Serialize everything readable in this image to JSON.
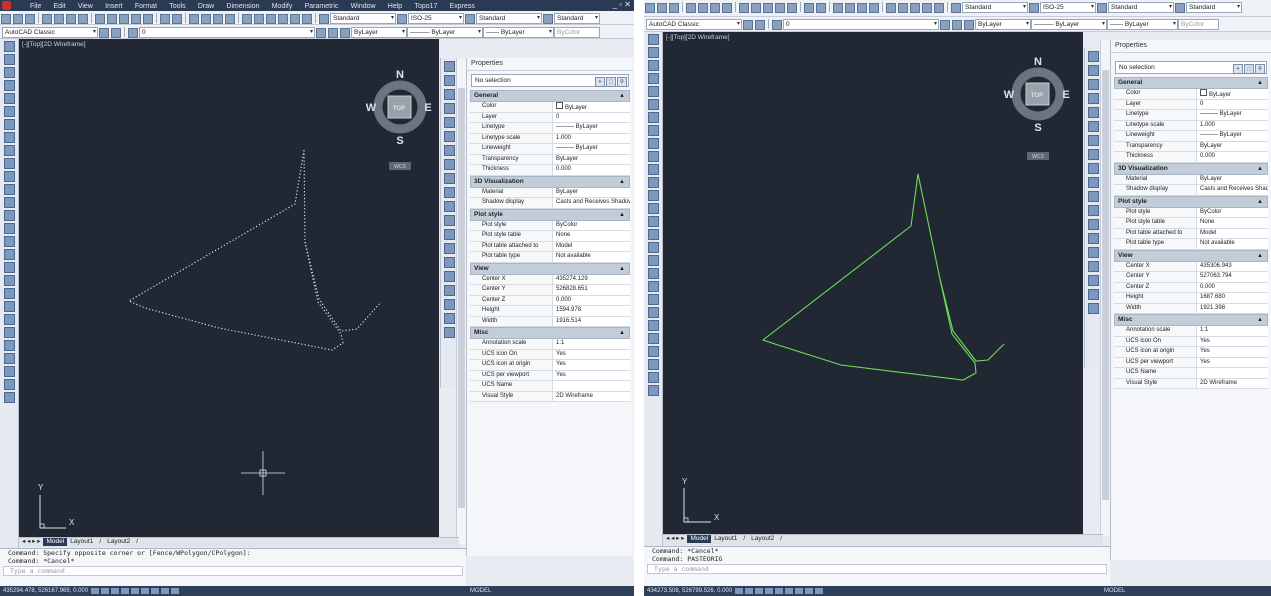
{
  "menu": [
    "File",
    "Edit",
    "View",
    "Insert",
    "Format",
    "Tools",
    "Draw",
    "Dimension",
    "Modify",
    "Parametric",
    "Window",
    "Help",
    "Topo17",
    "Express"
  ],
  "toolbar": {
    "style_text": "Standard",
    "dim_style": "ISO-25",
    "table_style": "Standard",
    "ml_style": "Standard",
    "workspace": "AutoCAD Classic",
    "layer": "0",
    "layer_right": "ByLayer",
    "color": "ByLayer",
    "linetype": "ByLayer",
    "lineweight": "ByLayer",
    "plotstyle": "ByColor"
  },
  "viewport_label": "[-][Top][2D Wireframe]",
  "compass": {
    "n": "N",
    "s": "S",
    "e": "E",
    "w": "W",
    "top": "TOP",
    "wcs": "WCS"
  },
  "ucs": {
    "x": "X",
    "y": "Y"
  },
  "left_window": {
    "props_title": "Properties",
    "selection": "No selection",
    "groups": [
      {
        "name": "General",
        "rows": [
          [
            "Color",
            "ByLayer"
          ],
          [
            "Layer",
            "0"
          ],
          [
            "Linetype",
            "——— ByLayer"
          ],
          [
            "Linetype scale",
            "1.000"
          ],
          [
            "Lineweight",
            "——— ByLayer"
          ],
          [
            "Transparency",
            "ByLayer"
          ],
          [
            "Thickness",
            "0.000"
          ]
        ]
      },
      {
        "name": "3D Visualization",
        "rows": [
          [
            "Material",
            "ByLayer"
          ],
          [
            "Shadow display",
            "Casts and Receives Shadows"
          ]
        ]
      },
      {
        "name": "Plot style",
        "rows": [
          [
            "Plot style",
            "ByColor"
          ],
          [
            "Plot style table",
            "None"
          ],
          [
            "Plot table attached to",
            "Model"
          ],
          [
            "Plot table type",
            "Not available"
          ]
        ]
      },
      {
        "name": "View",
        "rows": [
          [
            "Center X",
            "435274.129"
          ],
          [
            "Center Y",
            "526828.651"
          ],
          [
            "Center Z",
            "0.000"
          ],
          [
            "Height",
            "1594.978"
          ],
          [
            "Width",
            "1916.514"
          ]
        ]
      },
      {
        "name": "Misc",
        "rows": [
          [
            "Annotation scale",
            "1:1"
          ],
          [
            "UCS icon On",
            "Yes"
          ],
          [
            "UCS icon at origin",
            "Yes"
          ],
          [
            "UCS per viewport",
            "Yes"
          ],
          [
            "UCS Name",
            ""
          ],
          [
            "Visual Style",
            "2D Wireframe"
          ]
        ]
      }
    ],
    "cmd_lines": [
      "Command: Specify opposite corner or [Fence/WPolygon/CPolygon]:",
      "Command: *Cancel*"
    ],
    "cmd_prompt": "Type a command",
    "tabs": [
      "Model",
      "Layout1",
      "Layout2"
    ],
    "status_coords": "435294.478, 526167.969, 0.000",
    "status_right": "MODEL"
  },
  "right_window": {
    "props_title": "Properties",
    "selection": "No selection",
    "groups": [
      {
        "name": "General",
        "rows": [
          [
            "Color",
            "ByLayer"
          ],
          [
            "Layer",
            "0"
          ],
          [
            "Linetype",
            "——— ByLayer"
          ],
          [
            "Linetype scale",
            "1.000"
          ],
          [
            "Lineweight",
            "——— ByLayer"
          ],
          [
            "Transparency",
            "ByLayer"
          ],
          [
            "Thickness",
            "0.000"
          ]
        ]
      },
      {
        "name": "3D Visualization",
        "rows": [
          [
            "Material",
            "ByLayer"
          ],
          [
            "Shadow display",
            "Casts and Receives Shadows"
          ]
        ]
      },
      {
        "name": "Plot style",
        "rows": [
          [
            "Plot style",
            "ByColor"
          ],
          [
            "Plot style table",
            "None"
          ],
          [
            "Plot table attached to",
            "Model"
          ],
          [
            "Plot table type",
            "Not available"
          ]
        ]
      },
      {
        "name": "View",
        "rows": [
          [
            "Center X",
            "435306.943"
          ],
          [
            "Center Y",
            "527063.794"
          ],
          [
            "Center Z",
            "0.000"
          ],
          [
            "Height",
            "1687.680"
          ],
          [
            "Width",
            "1921.398"
          ]
        ]
      },
      {
        "name": "Misc",
        "rows": [
          [
            "Annotation scale",
            "1:1"
          ],
          [
            "UCS icon On",
            "Yes"
          ],
          [
            "UCS icon at origin",
            "Yes"
          ],
          [
            "UCS per viewport",
            "Yes"
          ],
          [
            "UCS Name",
            ""
          ],
          [
            "Visual Style",
            "2D Wireframe"
          ]
        ]
      }
    ],
    "cmd_lines": [
      "Command: *Cancel*",
      "Command: PASTEORIG"
    ],
    "cmd_prompt": "Type a command",
    "tabs": [
      "Model",
      "Layout1",
      "Layout2"
    ],
    "status_coords": "434273.508, 526799.526, 0.000",
    "status_right": "MODEL"
  },
  "colors": {
    "canvas": "#212833",
    "points_left": "#e8ecf0",
    "points_right": "#6fdc5a",
    "title": "#2a3a52"
  }
}
